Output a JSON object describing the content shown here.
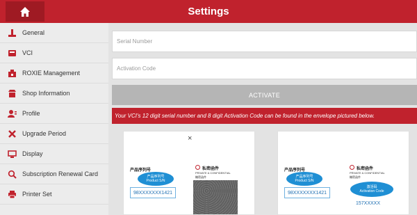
{
  "header": {
    "title": "Settings",
    "home_icon": "home-icon"
  },
  "sidebar": {
    "items": [
      {
        "label": "General",
        "icon": "general-icon"
      },
      {
        "label": "VCI",
        "icon": "vci-icon"
      },
      {
        "label": "ROXIE Management",
        "icon": "roxie-icon"
      },
      {
        "label": "Shop Information",
        "icon": "shop-icon"
      },
      {
        "label": "Profile",
        "icon": "profile-icon"
      },
      {
        "label": "Upgrade Period",
        "icon": "upgrade-icon"
      },
      {
        "label": "Display",
        "icon": "display-icon"
      },
      {
        "label": "Subscription Renewal Card",
        "icon": "search-icon"
      },
      {
        "label": "Printer Set",
        "icon": "printer-icon"
      }
    ]
  },
  "form": {
    "serial_placeholder": "Serial Number",
    "code_placeholder": "Activation Code",
    "activate_label": "ACTIVATE",
    "notice": "Your VCI's 12 digit serial number and 8 digit Activation Code can be found in the envelope pictured below."
  },
  "envelope_left": {
    "close_mark": "×",
    "cn_label": "产品序列号",
    "bubble_cn": "产品序列号",
    "bubble_en": "Product S/N",
    "serial": "98XXXXXXX1421",
    "company_cn": "私密函件",
    "company_en": "PRIVATE & CONFIDENTIAL",
    "company_sub": "機密函件"
  },
  "envelope_right": {
    "cn_label": "产品序列号",
    "bubble_cn": "产品序列号",
    "bubble_en": "Product S/N",
    "serial": "98XXXXXXX1421",
    "company_cn": "私密函件",
    "company_en": "PRIVATE & CONFIDENTIAL",
    "company_sub": "機密函件",
    "code_bubble_cn": "激活码",
    "code_bubble_en": "Activation Code",
    "code": "157XXXXX"
  },
  "colors": {
    "brand_red": "#c0222d",
    "home_dark": "#9f1a23",
    "bubble_blue": "#1f8fd4"
  }
}
